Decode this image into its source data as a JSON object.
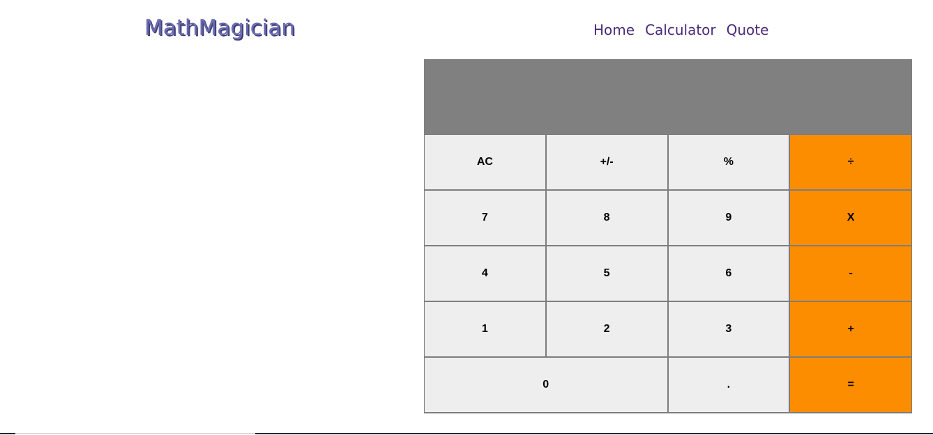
{
  "header": {
    "logo": "MathMagician",
    "nav": [
      {
        "label": "Home"
      },
      {
        "label": "Calculator"
      },
      {
        "label": "Quote"
      }
    ]
  },
  "calculator": {
    "display_value": "",
    "keys": [
      {
        "label": "AC",
        "name": "key-clear",
        "type": "function"
      },
      {
        "label": "+/-",
        "name": "key-sign",
        "type": "function"
      },
      {
        "label": "%",
        "name": "key-percent",
        "type": "function"
      },
      {
        "label": "÷",
        "name": "key-divide",
        "type": "operator"
      },
      {
        "label": "7",
        "name": "key-7",
        "type": "digit"
      },
      {
        "label": "8",
        "name": "key-8",
        "type": "digit"
      },
      {
        "label": "9",
        "name": "key-9",
        "type": "digit"
      },
      {
        "label": "X",
        "name": "key-multiply",
        "type": "operator"
      },
      {
        "label": "4",
        "name": "key-4",
        "type": "digit"
      },
      {
        "label": "5",
        "name": "key-5",
        "type": "digit"
      },
      {
        "label": "6",
        "name": "key-6",
        "type": "digit"
      },
      {
        "label": "-",
        "name": "key-subtract",
        "type": "operator"
      },
      {
        "label": "1",
        "name": "key-1",
        "type": "digit"
      },
      {
        "label": "2",
        "name": "key-2",
        "type": "digit"
      },
      {
        "label": "3",
        "name": "key-3",
        "type": "digit"
      },
      {
        "label": "+",
        "name": "key-add",
        "type": "operator"
      },
      {
        "label": "0",
        "name": "key-0",
        "type": "digit",
        "wide": true
      },
      {
        "label": ".",
        "name": "key-decimal",
        "type": "digit"
      },
      {
        "label": "=",
        "name": "key-equals",
        "type": "operator"
      }
    ]
  },
  "colors": {
    "display_bg": "#808080",
    "key_bg": "#eeeeee",
    "operator_bg": "#fd8d00",
    "logo": "#6b6bb0",
    "nav_link": "#4a2a7a"
  }
}
